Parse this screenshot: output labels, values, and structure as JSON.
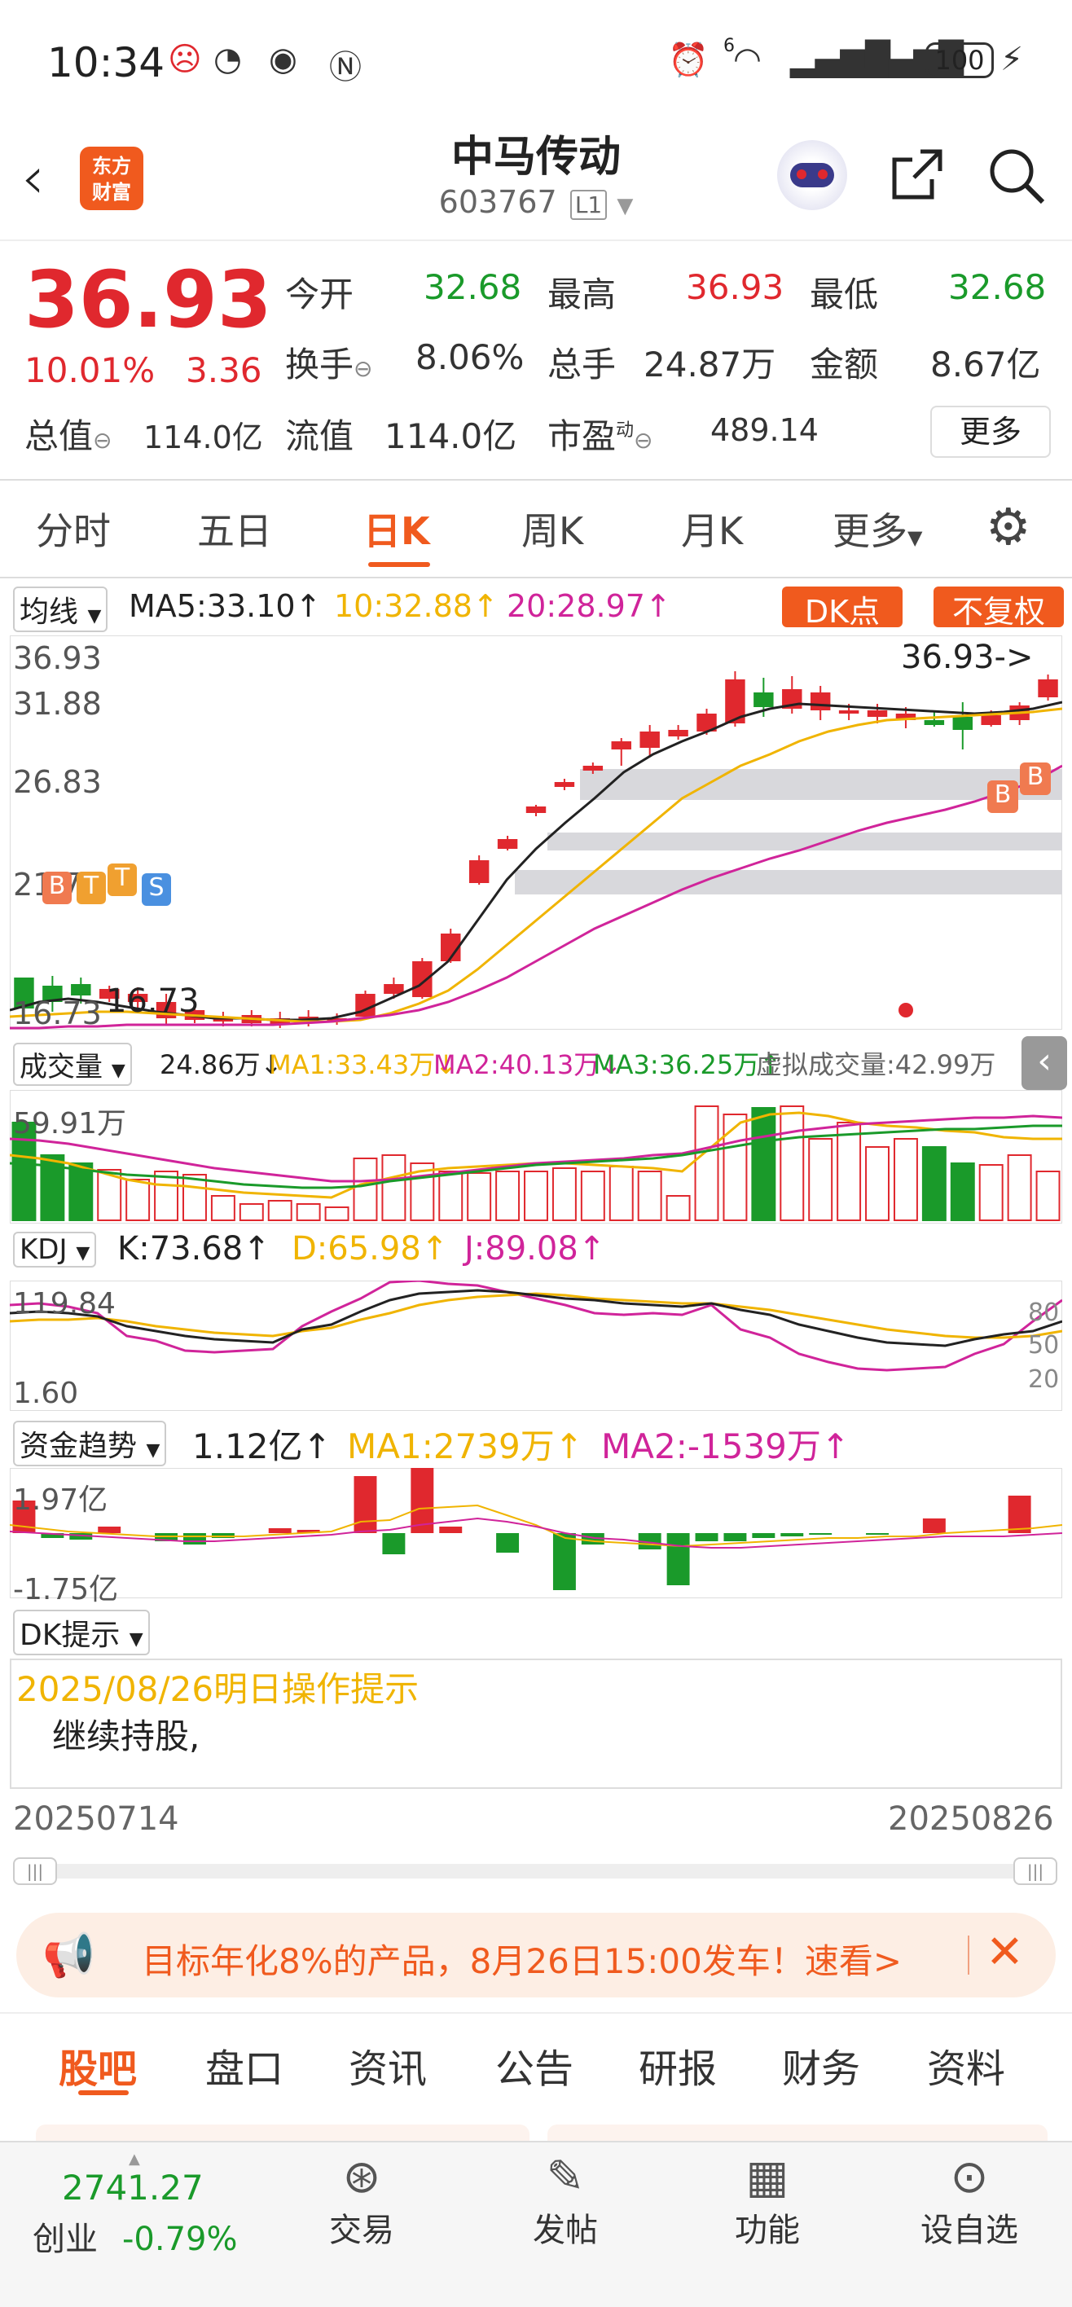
{
  "status_bar": {
    "time": "10:34",
    "battery": "100",
    "signal_sup": "6"
  },
  "header": {
    "title": "中马传动",
    "code": "603767",
    "market_tag": "L1",
    "logo_line1": "东方",
    "logo_line2": "财富"
  },
  "quote": {
    "price": "36.93",
    "change_pct": "10.01%",
    "change_amt": "3.36",
    "open_label": "今开",
    "open": "32.68",
    "high_label": "最高",
    "high": "36.93",
    "low_label": "最低",
    "low": "32.68",
    "turnover_label": "换手",
    "turnover": "8.06%",
    "volume_label": "总手",
    "volume": "24.87万",
    "amount_label": "金额",
    "amount": "8.67亿",
    "mktcap_label": "总值",
    "mktcap": "114.0亿",
    "float_label": "流值",
    "float": "114.0亿",
    "pe_label": "市盈",
    "pe_sup": "动",
    "pe": "489.14",
    "more_label": "更多"
  },
  "period_tabs": [
    "分时",
    "五日",
    "日K",
    "周K",
    "月K",
    "更多"
  ],
  "active_period": "日K",
  "main_chart": {
    "indicator": "均线",
    "ma5": "MA5:33.10↑",
    "ma10": "10:32.88↑",
    "ma20": "20:28.97↑",
    "dk_label": "DK点",
    "adjust_label": "不复权",
    "y_labels": [
      "36.93",
      "31.88",
      "26.83",
      "21.78",
      "16.73"
    ],
    "max_label": "36.93->",
    "min_label": "16.73",
    "signals": [
      "B",
      "T",
      "T",
      "S",
      "B",
      "B"
    ]
  },
  "volume_panel": {
    "name": "成交量",
    "value": "24.86万↓",
    "ma1": "MA1:33.43万↓",
    "ma2": "MA2:40.13万↓",
    "ma3": "MA3:36.25万↑",
    "virtual": "虚拟成交量:42.99万",
    "y_top": "59.91万"
  },
  "kdj_panel": {
    "name": "KDJ",
    "k": "K:73.68↑",
    "d": "D:65.98↑",
    "j": "J:89.08↑",
    "y_top": "119.84",
    "y_bottom": "1.60",
    "levels": [
      "80",
      "50",
      "20"
    ]
  },
  "fund_panel": {
    "name": "资金趋势",
    "value": "1.12亿↑",
    "ma1": "MA1:2739万↑",
    "ma2": "MA2:-1539万↑",
    "y_top": "1.97亿",
    "y_bottom": "-1.75亿"
  },
  "dk_tip": {
    "name": "DK提示",
    "date_title": "2025/08/26明日操作提示",
    "text": "继续持股,"
  },
  "date_range": {
    "start": "20250714",
    "end": "20250826"
  },
  "ad_banner": {
    "text": "目标年化8%的产品，8月26日15:00发车！速看>"
  },
  "bottom_tabs": [
    "股吧",
    "盘口",
    "资讯",
    "公告",
    "研报",
    "财务",
    "资料"
  ],
  "active_bottom_tab": "股吧",
  "nav": {
    "index_value": "2741.27",
    "index_name": "创业",
    "index_change": "-0.79%",
    "items": [
      {
        "label": "交易",
        "icon": "yuan-icon"
      },
      {
        "label": "发帖",
        "icon": "edit-icon"
      },
      {
        "label": "功能",
        "icon": "grid-icon"
      },
      {
        "label": "设自选",
        "icon": "more-icon"
      }
    ]
  },
  "colors": {
    "up": "#e0282e",
    "down": "#1a9a2a",
    "ma5": "#222222",
    "ma10": "#f0b400",
    "ma20": "#d0249a",
    "accent": "#f05a1e"
  }
}
